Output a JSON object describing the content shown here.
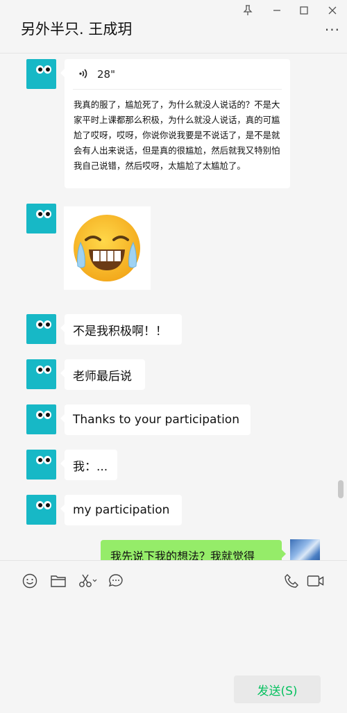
{
  "header": {
    "title": "另外半只. 王成玥",
    "pin_icon": "pin-icon",
    "minimize_icon": "minimize-icon",
    "maximize_icon": "maximize-icon",
    "close_icon": "close-icon",
    "more_icon": "more-icon"
  },
  "messages": {
    "voice": {
      "duration": "28\"",
      "transcript": "我真的服了，尴尬死了，为什么就没人说话的？不是大家平时上课都那么积极，为什么就没人说话，真的可尴尬了哎呀，哎呀，你说你说我要是不说话了，是不是就会有人出来说话，但是真的很尴尬，然后就我又特别怕我自己说错，然后哎呀，太尴尬了太尴尬了。"
    },
    "sticker": "crying-laughing-emoji",
    "m1": "不是我积极啊！！",
    "m2": "老师最后说",
    "m3": "Thanks to your participation",
    "m4": "我：...",
    "m5": "my participation",
    "me1": "我先说下我的想法？我就觉得"
  },
  "toolbar": {
    "icons": [
      "emoji-icon",
      "folder-icon",
      "scissors-icon",
      "chat-icon",
      "phone-icon",
      "video-icon"
    ]
  },
  "send_label": "发送(S)",
  "colors": {
    "avatar": "#17b8c6",
    "me_bubble": "#95ec69",
    "send_text": "#07c160"
  }
}
